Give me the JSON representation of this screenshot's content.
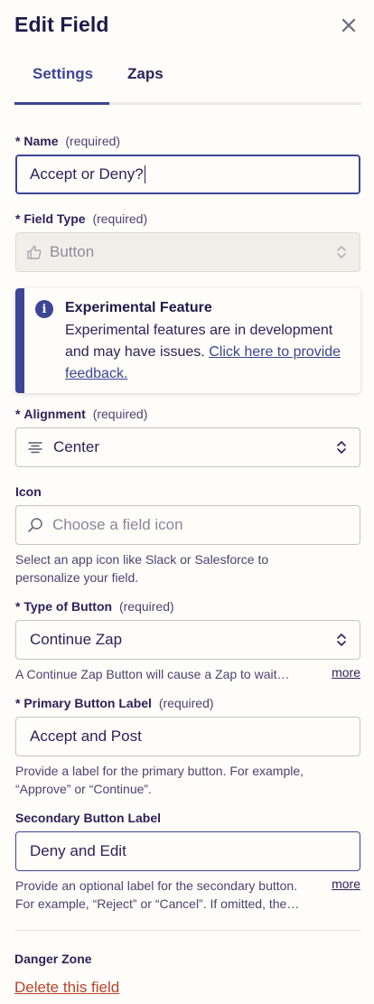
{
  "header": {
    "title": "Edit Field",
    "close_icon": "close-icon"
  },
  "tabs": [
    {
      "label": "Settings",
      "active": true
    },
    {
      "label": "Zaps",
      "active": false
    }
  ],
  "name_field": {
    "label": "Name",
    "required": "(required)",
    "value": "Accept or Deny?"
  },
  "field_type": {
    "label": "Field Type",
    "required": "(required)",
    "value": "Button",
    "icon": "thumbs-up-icon"
  },
  "alert": {
    "title": "Experimental Feature",
    "body": "Experimental features are in development and may have issues.",
    "link": "Click here to provide feedback."
  },
  "alignment": {
    "label": "Alignment",
    "required": "(required)",
    "value": "Center",
    "icon": "align-center-icon"
  },
  "icon_field": {
    "label": "Icon",
    "placeholder": "Choose a field icon",
    "help_line1": "Select an app icon like Slack or Salesforce to",
    "help_line2": "personalize your field."
  },
  "button_type": {
    "label": "Type of Button",
    "required": "(required)",
    "value": "Continue Zap",
    "help": "A Continue Zap Button will cause a Zap to wait…",
    "more": "more"
  },
  "primary_label": {
    "label": "Primary Button Label",
    "required": "(required)",
    "value": "Accept and Post",
    "help_line1": "Provide a label for the primary button. For example,",
    "help_line2": "“Approve” or “Continue”."
  },
  "secondary_label": {
    "label": "Secondary Button Label",
    "value": "Deny and Edit",
    "help_line1": "Provide an optional label for the secondary button.",
    "help_line2": "For example, “Reject” or “Cancel”. If omitted, the…",
    "more": "more"
  },
  "danger": {
    "title": "Danger Zone",
    "delete_label": "Delete this field"
  },
  "asterisk": "*",
  "colors": {
    "accent": "#3d4594",
    "danger": "#b8432a",
    "text": "#2b2358"
  }
}
